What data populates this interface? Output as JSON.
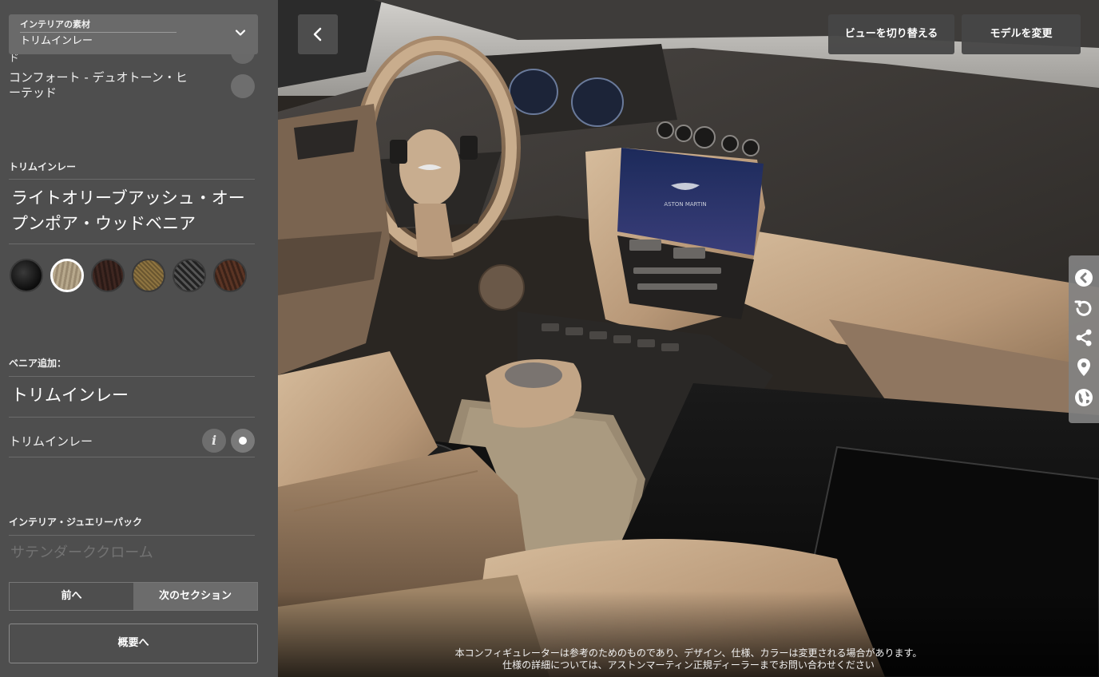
{
  "sidebar": {
    "section_select": {
      "category": "インテリアの素材",
      "value": "トリムインレー"
    },
    "cut_text": "ド",
    "comfort_option": {
      "label": "コンフォート - デュオトーン・ヒーテッド"
    },
    "trim_inlay": {
      "heading": "トリムインレー",
      "selected_name": "ライトオリーブアッシュ・オープンポア・ウッドベニア",
      "swatches": [
        {
          "name": "swatch-piano-black",
          "color": "#111111",
          "selected": false
        },
        {
          "name": "swatch-light-olive-ash",
          "color": "#a8997e",
          "selected": true
        },
        {
          "name": "swatch-dark-wood",
          "color": "#32201b",
          "selected": false
        },
        {
          "name": "swatch-gold-weave",
          "color": "#7c6638",
          "selected": false
        },
        {
          "name": "swatch-carbon-fibre",
          "color": "#3c3c3c",
          "selected": false
        },
        {
          "name": "swatch-walnut",
          "color": "#4a2c20",
          "selected": false
        }
      ]
    },
    "veneer_add": {
      "heading": "ベニア追加：",
      "value": "トリムインレー",
      "option_label": "トリムインレー",
      "info_glyph": "i"
    },
    "jewellery_pack": {
      "heading": "インテリア・ジュエリーパック",
      "faded_value": "サテンダーククローム"
    },
    "nav": {
      "prev": "前へ",
      "next": "次のセクション",
      "overview": "概要へ"
    }
  },
  "viewer": {
    "buttons": {
      "switch_view": "ビューを切り替える",
      "change_model": "モデルを変更"
    },
    "screen_logo": "ASTON MARTIN",
    "disclaimer": {
      "line1": "本コンフィギュレーターは参考のためのものであり、デザイン、仕様、カラーは変更される場合があります。",
      "line2": "仕様の詳細については、アストンマーティン正規ディーラーまでお問い合わせください"
    },
    "tools": [
      "chevron-left-icon",
      "rotate-icon",
      "share-icon",
      "location-pin-icon",
      "globe-icon"
    ]
  },
  "colors": {
    "panel_bg": "#4e4e4e",
    "leather": "#c4a88a",
    "dash_dark": "#3f3b38"
  }
}
